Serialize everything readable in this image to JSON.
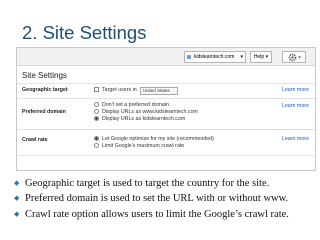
{
  "slide": {
    "title": "2. Site Settings"
  },
  "toolbar": {
    "site": "kidslearntech.com",
    "help": "Help",
    "chevron": "▾",
    "gear": "gear-icon"
  },
  "settings": {
    "heading": "Site Settings",
    "learn_more": "Learn more",
    "geo": {
      "label": "Geographic target",
      "checkbox": "Target users in",
      "country": "United States"
    },
    "preferred": {
      "label": "Preferred domain",
      "options": [
        "Don't set a preferred domain",
        "Display URLs as www.kidslearntech.com",
        "Display URLs as kidslearntech.com"
      ],
      "selected": 2
    },
    "crawl": {
      "label": "Crawl rate",
      "options": [
        "Let Google optimize for my site (recommended)",
        "Limit Google's maximum crawl rate"
      ],
      "selected": 0
    }
  },
  "bullets": [
    "Geographic target is used to target the country for the site.",
    "Preferred domain is used to set the URL with or without www.",
    "Crawl rate option allows users to limit the Google’s crawl rate."
  ],
  "colors": {
    "title": "#1f4e79",
    "bullet": "#2e75b6",
    "link": "#1155cc"
  }
}
